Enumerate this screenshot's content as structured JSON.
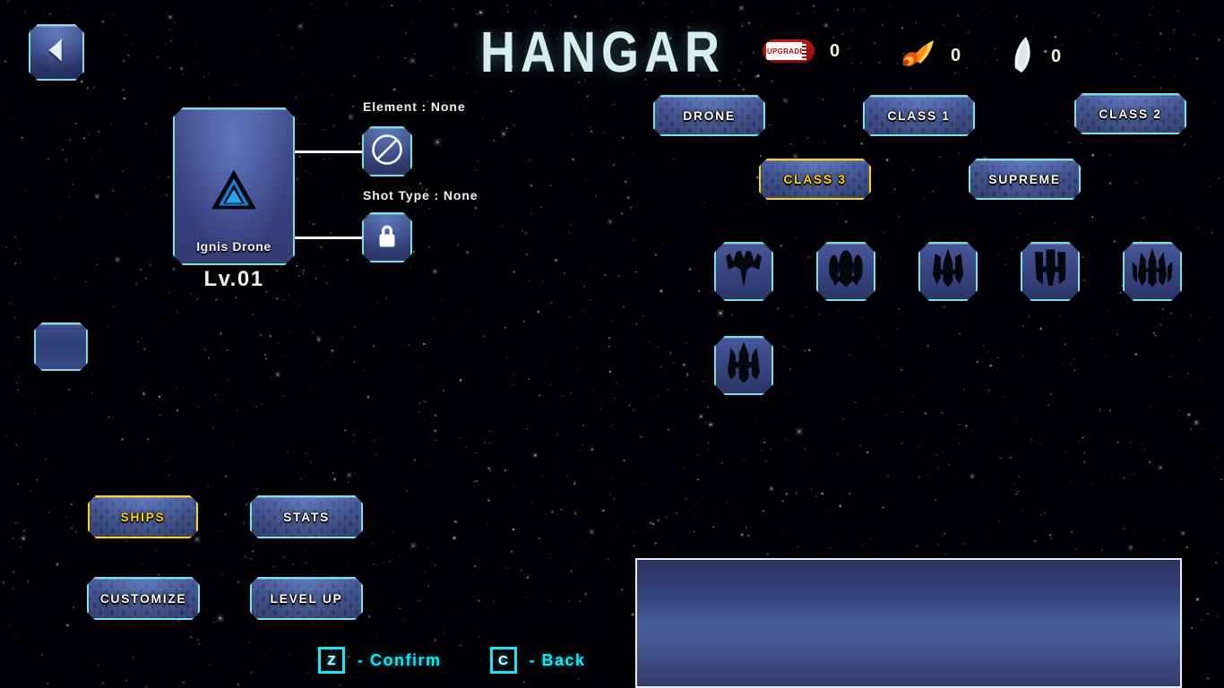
{
  "header": {
    "title": "HANGAR",
    "back_button": "back-arrow",
    "currencies": [
      {
        "icon": "upgrade-ticket-icon",
        "label": "UPGRADE",
        "count": "0"
      },
      {
        "icon": "meteor-icon",
        "label": "",
        "count": "0"
      },
      {
        "icon": "feather-crystal-icon",
        "label": "",
        "count": "0"
      }
    ]
  },
  "ship_preview": {
    "card_name": "Ignis Drone",
    "level": "Lv.01",
    "emblem": "triangle-emblem",
    "attributes": [
      {
        "label": "Element : None",
        "icon": "no-element-icon"
      },
      {
        "label": "Shot Type : None",
        "icon": "lock-icon"
      }
    ]
  },
  "class_tabs": [
    {
      "label": "DRONE",
      "selected": false
    },
    {
      "label": "CLASS 1",
      "selected": false
    },
    {
      "label": "CLASS 2",
      "selected": false
    },
    {
      "label": "CLASS 3",
      "selected": true
    },
    {
      "label": "SUPREME",
      "selected": false
    }
  ],
  "ship_slots": [
    {
      "name": "ship-slot-1",
      "icon": "fighter-wide-wings"
    },
    {
      "name": "ship-slot-2",
      "icon": "fighter-triple-pod"
    },
    {
      "name": "ship-slot-3",
      "icon": "fighter-spear-nose"
    },
    {
      "name": "ship-slot-4",
      "icon": "fighter-twin-prong"
    },
    {
      "name": "ship-slot-5",
      "icon": "fighter-spread-fins"
    },
    {
      "name": "ship-slot-6",
      "icon": "fighter-trident"
    }
  ],
  "menu_buttons": [
    {
      "label": "SHIPS",
      "selected": true
    },
    {
      "label": "STATS",
      "selected": false
    },
    {
      "label": "CUSTOMIZE",
      "selected": false
    },
    {
      "label": "LEVEL UP",
      "selected": false
    }
  ],
  "description_panel": {
    "text": ""
  },
  "key_hints": [
    {
      "key": "Z",
      "action": "- Confirm"
    },
    {
      "key": "C",
      "action": "- Back"
    }
  ],
  "colors": {
    "accent_cyan": "#79e4e4",
    "selected_yellow": "#ffd400",
    "hint_cyan": "#11eaf2",
    "panel_blue": "#4a5e9e",
    "title_white": "#d6eef0"
  }
}
